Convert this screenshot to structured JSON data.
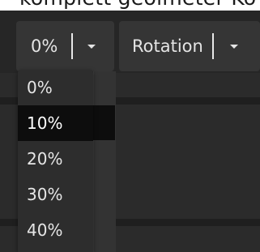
{
  "header": {
    "cut_off_text": "komplett geölmeter Ko"
  },
  "toolbar": {
    "percent_select": {
      "value": "0%"
    },
    "rotation_select": {
      "value": "Rotation"
    }
  },
  "dropdown": {
    "selected_index": 1,
    "options": [
      {
        "label": "0%"
      },
      {
        "label": "10%"
      },
      {
        "label": "20%"
      },
      {
        "label": "30%"
      },
      {
        "label": "40%"
      }
    ]
  },
  "colors": {
    "toolbar_bg": "#262626",
    "field_bg": "#353535",
    "dropdown_bg": "#2d2d2d",
    "selected_bg": "#0d0d0d",
    "text": "#e4e4e4"
  }
}
